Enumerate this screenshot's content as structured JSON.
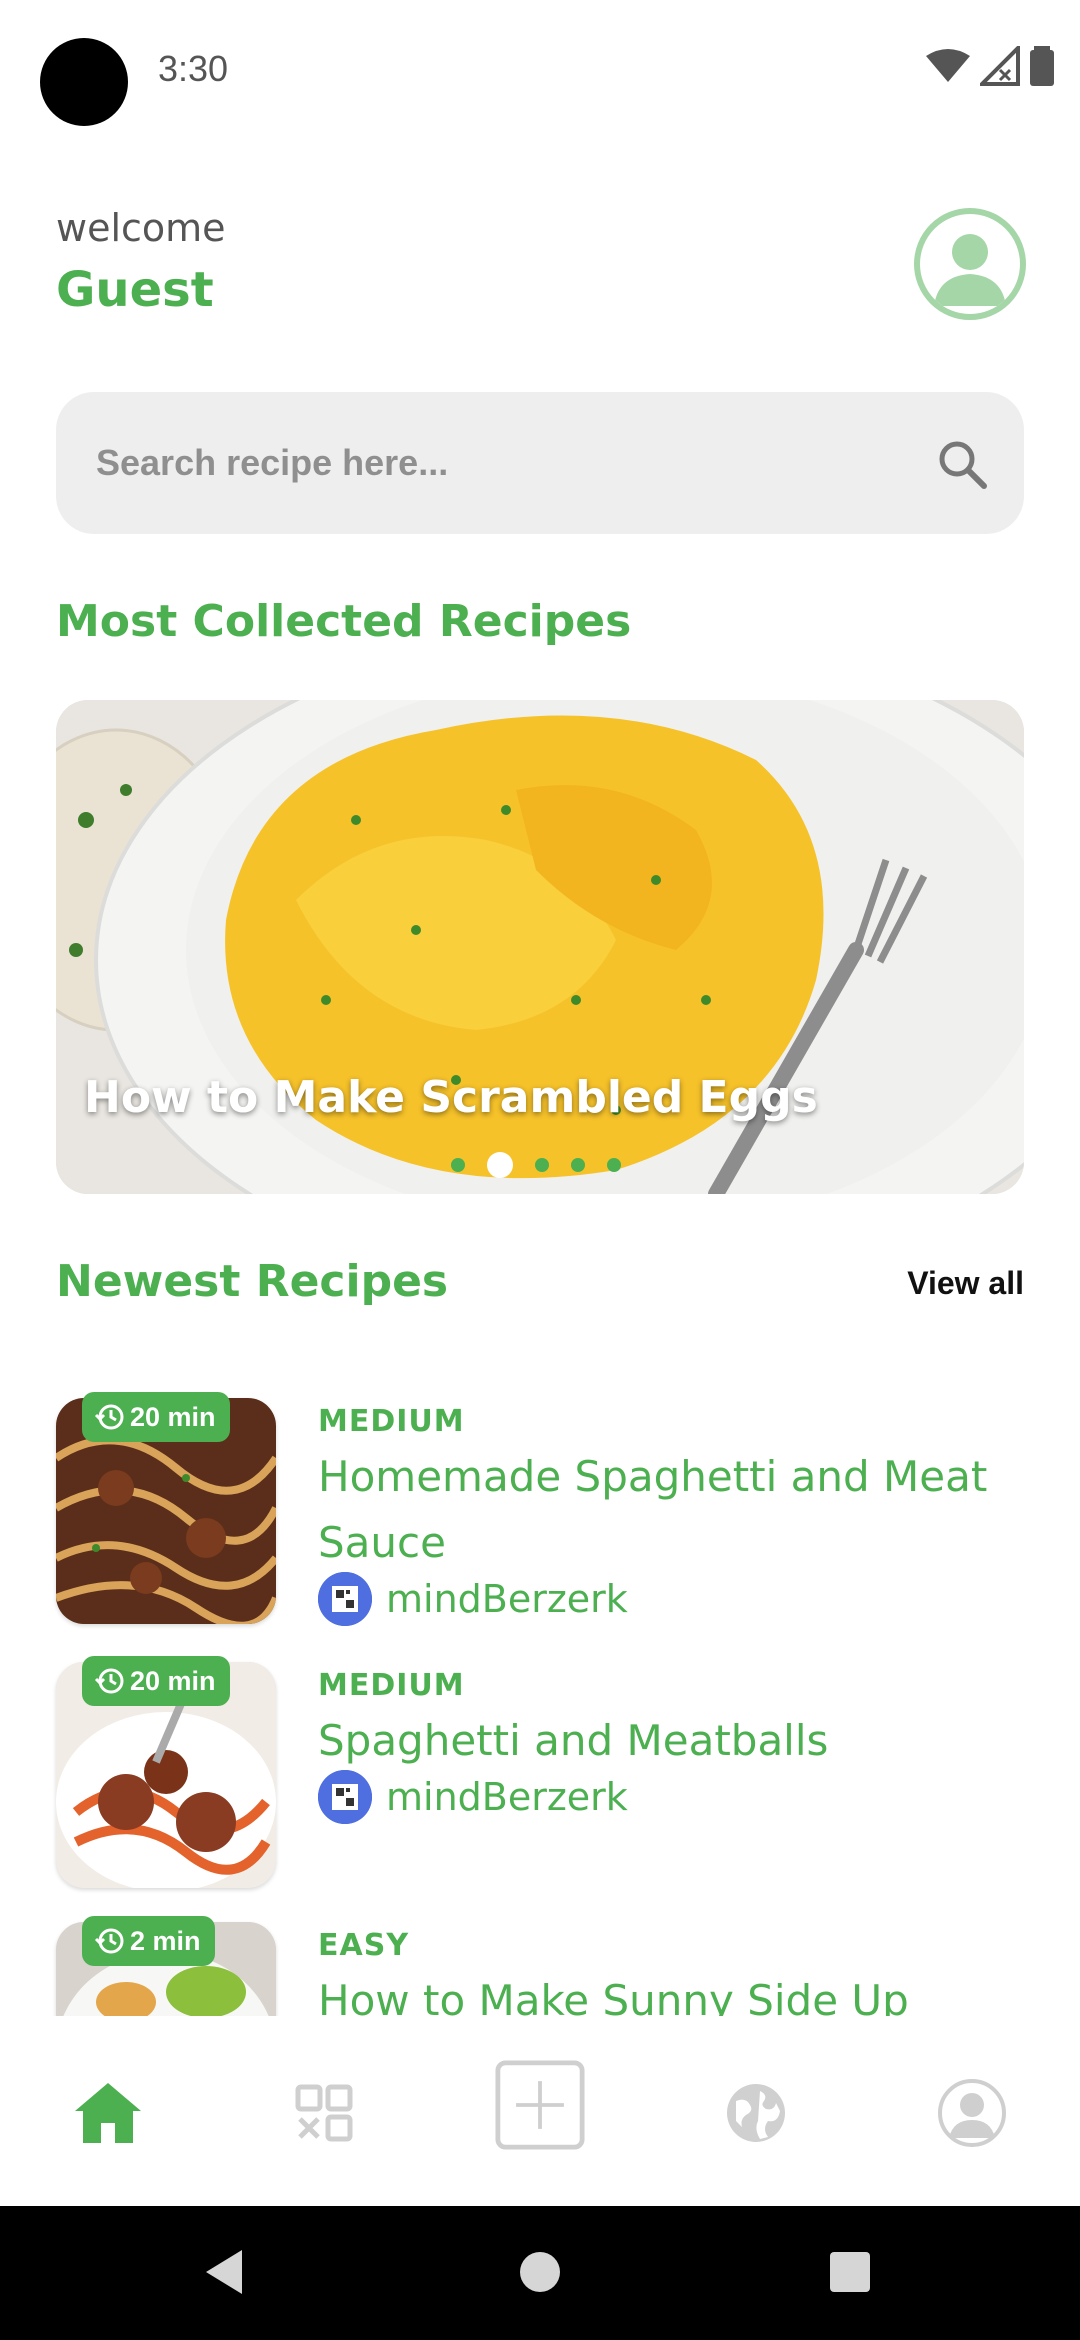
{
  "status_bar": {
    "time": "3:30"
  },
  "header": {
    "welcome": "welcome",
    "user_name": "Guest"
  },
  "search": {
    "placeholder": "Search recipe here..."
  },
  "most_collected": {
    "title": "Most Collected Recipes",
    "featured_caption": "How to Make Scrambled Eggs",
    "slide_count": 5,
    "active_slide": 1
  },
  "newest": {
    "title": "Newest Recipes",
    "view_all": "View all",
    "recipes": [
      {
        "time": "20 min",
        "level": "MEDIUM",
        "title": "Homemade Spaghetti and Meat Sauce",
        "author": "mindBerzerk"
      },
      {
        "time": "20 min",
        "level": "MEDIUM",
        "title": "Spaghetti and Meatballs",
        "author": "mindBerzerk"
      },
      {
        "time": "2 min",
        "level": "EASY",
        "title": "How to Make Sunny Side Up",
        "author": ""
      }
    ]
  },
  "bottom_nav": [
    "home",
    "categories",
    "add",
    "explore",
    "profile"
  ],
  "colors": {
    "accent": "#4caf50",
    "accent_light": "#a5d6a7",
    "search_bg": "#eeeeee"
  }
}
